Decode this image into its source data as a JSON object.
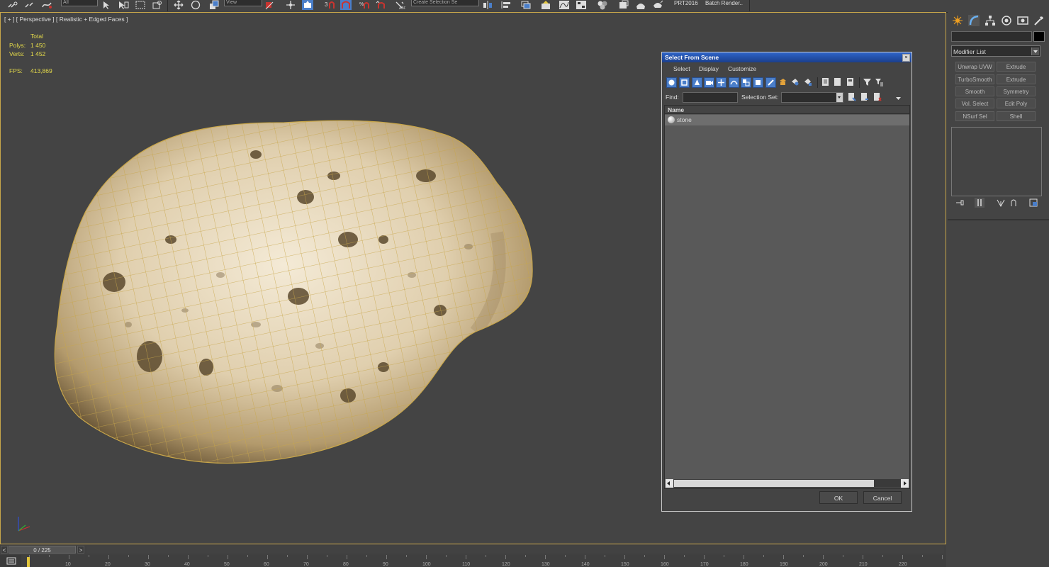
{
  "toolbar": {
    "filter_dropdown": "All",
    "view_dropdown": "View",
    "selection_set_dropdown": "Create Selection Se",
    "prt_label": "PRT2016",
    "batch_render_label": "Batch Render..",
    "icons": [
      "select-link-icon",
      "unlink-icon",
      "bind-spacewarp-icon",
      "select-object-icon",
      "select-by-name-icon",
      "rect-region-icon",
      "window-crossing-icon",
      "move-icon",
      "rotate-icon",
      "scale-icon",
      "pivot-icon",
      "manipulate-icon",
      "keyboard-shortcut-icon",
      "snap-toggle-icon",
      "angle-snap-icon",
      "percent-snap-icon",
      "spinner-snap-icon",
      "edit-named-sets-icon",
      "mirror-icon",
      "align-icon",
      "layer-explorer-icon",
      "scene-explorer-icon",
      "curve-editor-icon",
      "schematic-view-icon",
      "material-editor-icon",
      "render-setup-icon",
      "rendered-frame-icon",
      "render-icon"
    ]
  },
  "viewport": {
    "label": "[ + ] [ Perspective ] [ Realistic + Edged Faces ]",
    "stats": {
      "total_label": "Total",
      "polys_label": "Polys:",
      "polys_value": "1 450",
      "verts_label": "Verts:",
      "verts_value": "1 452",
      "fps_label": "FPS:",
      "fps_value": "413,869"
    },
    "object_name": "stone",
    "colors": {
      "wire": "#c8a64a",
      "stats": "#e3d94a",
      "background": "#444444"
    }
  },
  "dialog": {
    "title": "Select From Scene",
    "close_glyph": "×",
    "menus": [
      "Select",
      "Display",
      "Customize"
    ],
    "find_label": "Find:",
    "find_value": "",
    "selection_set_label": "Selection Set:",
    "selection_set_value": "",
    "column_name": "Name",
    "items": [
      "stone"
    ],
    "ok_label": "OK",
    "cancel_label": "Cancel",
    "toolbar_icons": [
      "display-geometry-icon",
      "display-shapes-icon",
      "display-lights-icon",
      "display-cameras-icon",
      "display-helpers-icon",
      "display-spacewarps-icon",
      "display-groups-icon",
      "display-xrefs-icon",
      "display-bones-icon",
      "display-all-icon",
      "display-none-icon",
      "invert-display-icon",
      "sync-selection-icon",
      "lock-icon",
      "filter-icon",
      "filter-options-icon"
    ]
  },
  "command_panel": {
    "modifier_list_label": "Modifier List",
    "modifiers": [
      "Unwrap UVW",
      "Extrude",
      "TurboSmooth",
      "Extrude",
      "Smooth",
      "Symmetry",
      "Vol. Select",
      "Edit Poly",
      "NSurf Sel",
      "Shell"
    ],
    "tabs": [
      "create-tab-icon",
      "modify-tab-icon",
      "hierarchy-tab-icon",
      "motion-tab-icon",
      "display-tab-icon",
      "utilities-tab-icon"
    ],
    "stack_icons": [
      "pin-stack-icon",
      "show-end-result-icon",
      "make-unique-icon",
      "remove-modifier-icon",
      "configure-modifier-sets-icon"
    ]
  },
  "timeline": {
    "prev": "<",
    "next": ">",
    "frame_display": "0 / 225",
    "ticks": [
      "10",
      "20",
      "30",
      "40",
      "50",
      "60",
      "70",
      "80",
      "90",
      "100",
      "110",
      "120",
      "130",
      "140",
      "150",
      "160",
      "170",
      "180",
      "190",
      "200",
      "210",
      "220"
    ]
  }
}
